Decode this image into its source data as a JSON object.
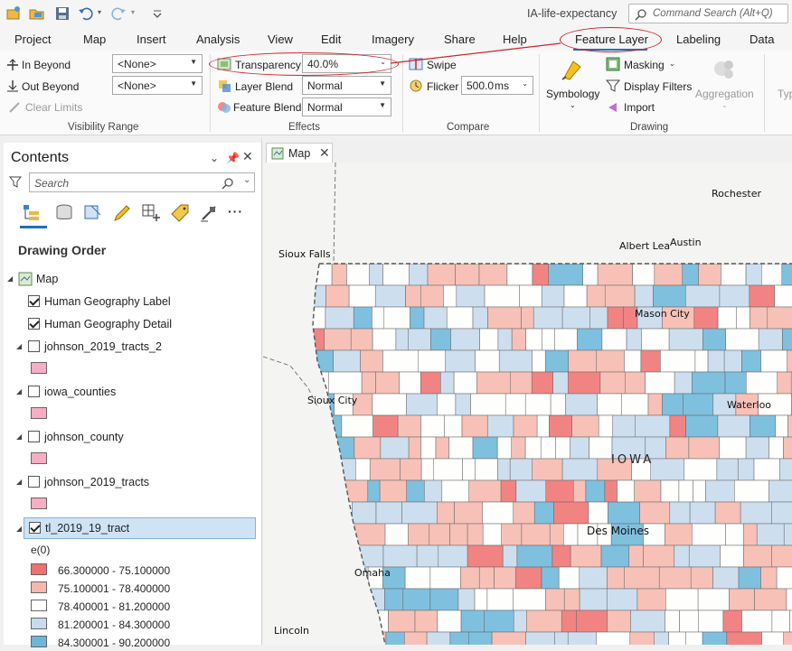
{
  "app": {
    "title": "IA-life-expectancy",
    "command_search_placeholder": "Command Search (Alt+Q)"
  },
  "tabs": [
    "Project",
    "Map",
    "Insert",
    "Analysis",
    "View",
    "Edit",
    "Imagery",
    "Share",
    "Help",
    "Feature Layer",
    "Labeling",
    "Data"
  ],
  "ribbon": {
    "visibility_range": {
      "title": "Visibility Range",
      "in_beyond": "In Beyond",
      "in_beyond_value": "<None>",
      "out_beyond": "Out Beyond",
      "out_beyond_value": "<None>",
      "clear_limits": "Clear Limits"
    },
    "effects": {
      "title": "Effects",
      "transparency": "Transparency",
      "transparency_value": "40.0%",
      "layer_blend": "Layer Blend",
      "layer_blend_value": "Normal",
      "feature_blend": "Feature Blend",
      "feature_blend_value": "Normal"
    },
    "compare": {
      "title": "Compare",
      "swipe": "Swipe",
      "flicker": "Flicker",
      "flicker_value": "500.0",
      "flicker_unit": "ms"
    },
    "drawing": {
      "title": "Drawing",
      "symbology": "Symbology",
      "masking": "Masking",
      "display_filters": "Display Filters",
      "import": "Import",
      "aggregation": "Aggregation",
      "type_partial": "Typ"
    }
  },
  "contents": {
    "title": "Contents",
    "search_placeholder": "Search",
    "drawing_order": "Drawing Order",
    "layers": [
      {
        "label": "Map"
      },
      {
        "label": "Human Geography Label"
      },
      {
        "label": "Human Geography Detail"
      },
      {
        "label": "johnson_2019_tracts_2"
      },
      {
        "label": "iowa_counties"
      },
      {
        "label": "johnson_county"
      },
      {
        "label": "johnson_2019_tracts"
      },
      {
        "label": "tl_2019_19_tract"
      }
    ],
    "field": "e(0)",
    "legend": [
      {
        "label": "66.300000 - 75.100000",
        "color": "#f07070"
      },
      {
        "label": "75.100001 - 78.400000",
        "color": "#f7b7ad"
      },
      {
        "label": "78.400001 - 81.200000",
        "color": "#ffffff"
      },
      {
        "label": "81.200001 - 84.300000",
        "color": "#c6dbef"
      },
      {
        "label": "84.300001 - 90.200000",
        "color": "#6ab6dc"
      }
    ],
    "layer_swatch_color": "#f7aec4"
  },
  "map": {
    "tab_label": "Map",
    "cities": [
      "Rochester",
      "Albert Lea",
      "Austin",
      "Sioux Falls",
      "Mason City",
      "Sioux City",
      "Waterloo",
      "Des Moines",
      "Omaha",
      "Lincoln"
    ],
    "state_label": "IOWA"
  }
}
